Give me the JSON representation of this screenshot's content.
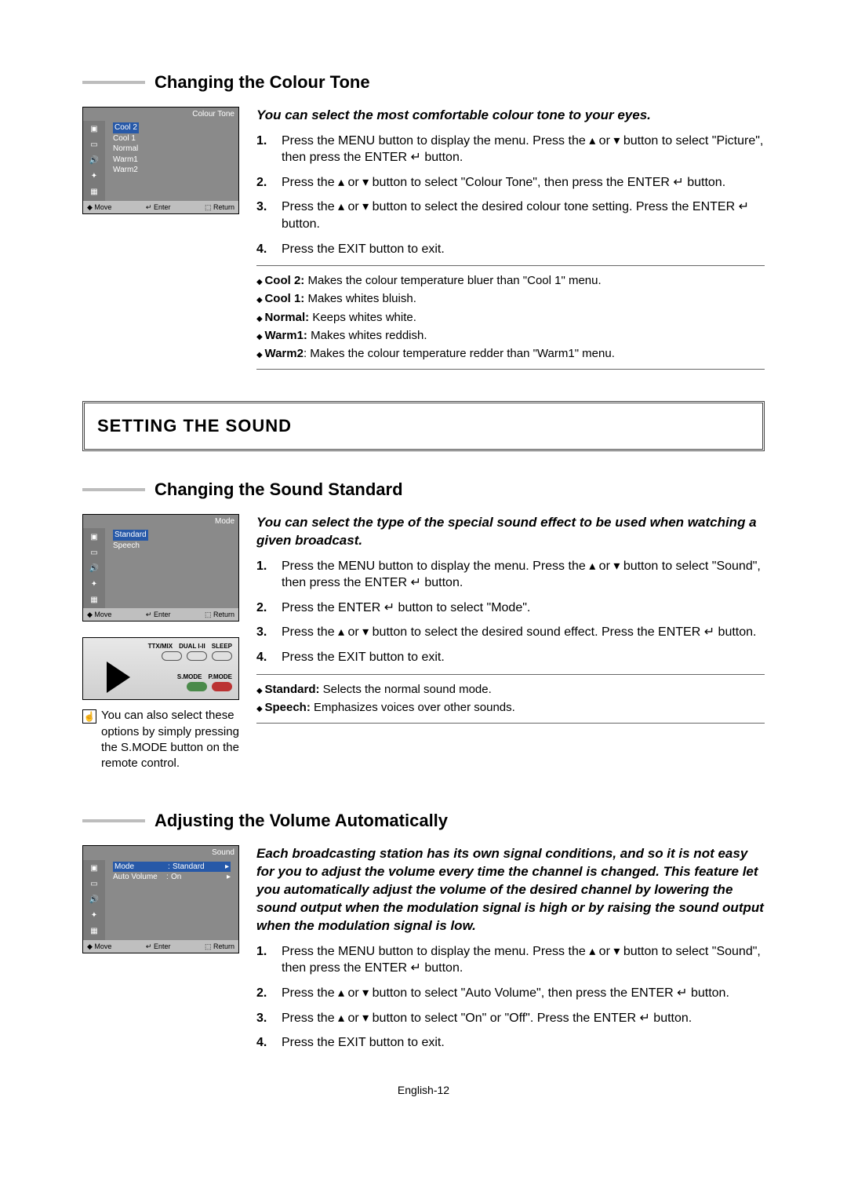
{
  "section1": {
    "title": "Changing the Colour Tone",
    "intro": "You can select the most comfortable colour tone to your eyes.",
    "steps": [
      "Press the MENU button to display the menu. Press the ▴ or ▾ button to select \"Picture\", then press the ENTER ↵ button.",
      "Press the ▴ or ▾ button to select \"Colour Tone\", then press the ENTER ↵ button.",
      "Press the ▴ or ▾ button to select the desired colour tone setting. Press the ENTER ↵ button.",
      "Press the EXIT button to exit."
    ],
    "notes": [
      {
        "label": "Cool 2:",
        "text": " Makes the colour temperature bluer than \"Cool 1\" menu."
      },
      {
        "label": "Cool 1:",
        "text": " Makes whites bluish."
      },
      {
        "label": "Normal:",
        "text": " Keeps whites white."
      },
      {
        "label": "Warm1:",
        "text": " Makes whites reddish."
      },
      {
        "label": "Warm2",
        "text": ": Makes the colour temperature redder than \"Warm1\" menu."
      }
    ],
    "osd": {
      "title": "Colour Tone",
      "items": [
        "Cool 2",
        "Cool 1",
        "Normal",
        "Warm1",
        "Warm2"
      ],
      "foot": {
        "move": "◆ Move",
        "enter": "↵ Enter",
        "return": "⬚ Return"
      }
    }
  },
  "bigTitle": "SETTING THE SOUND",
  "section2": {
    "title": "Changing the Sound Standard",
    "intro": "You can select the type of the special sound effect to be used when watching a given broadcast.",
    "steps": [
      "Press the MENU button to display the menu. Press the ▴ or ▾ button to select \"Sound\", then press the ENTER ↵ button.",
      "Press the ENTER ↵ button to select \"Mode\".",
      "Press the ▴ or ▾ button to select the desired sound effect. Press the ENTER ↵ button.",
      "Press the EXIT button to exit."
    ],
    "notes": [
      {
        "label": "Standard:",
        "text": " Selects the normal sound mode."
      },
      {
        "label": "Speech:",
        "text": " Emphasizes voices over other sounds."
      }
    ],
    "osd": {
      "title": "Mode",
      "items": [
        "Standard",
        "Speech"
      ],
      "foot": {
        "move": "◆ Move",
        "enter": "↵ Enter",
        "return": "⬚ Return"
      }
    },
    "remoteLabels1": [
      "TTX/MIX",
      "DUAL I-II",
      "SLEEP"
    ],
    "remoteLabels2": [
      "S.MODE",
      "P.MODE"
    ],
    "tip": "You can also select these options by simply pressing the S.MODE button on the remote control."
  },
  "section3": {
    "title": "Adjusting the Volume Automatically",
    "intro": "Each broadcasting station has its own signal conditions, and so it is not easy for you to adjust the volume every time the channel is changed. This feature let you automatically adjust the volume of the desired channel by lowering the sound output when the modulation signal is high or by raising the sound output when the modulation signal is low.",
    "steps": [
      "Press the MENU button to display the menu. Press the ▴ or ▾ button to select \"Sound\", then press the ENTER ↵ button.",
      "Press the ▴ or ▾ button to select \"Auto Volume\", then press the ENTER ↵ button.",
      "Press the ▴ or ▾ button to select \"On\" or \"Off\". Press the ENTER ↵ button.",
      "Press the EXIT button to exit."
    ],
    "osd": {
      "title": "Sound",
      "rows": [
        {
          "k": "Mode",
          "v": "Standard"
        },
        {
          "k": "Auto Volume",
          "v": "On"
        }
      ],
      "foot": {
        "move": "◆ Move",
        "enter": "↵ Enter",
        "return": "⬚ Return"
      }
    }
  },
  "footer": "English-12"
}
